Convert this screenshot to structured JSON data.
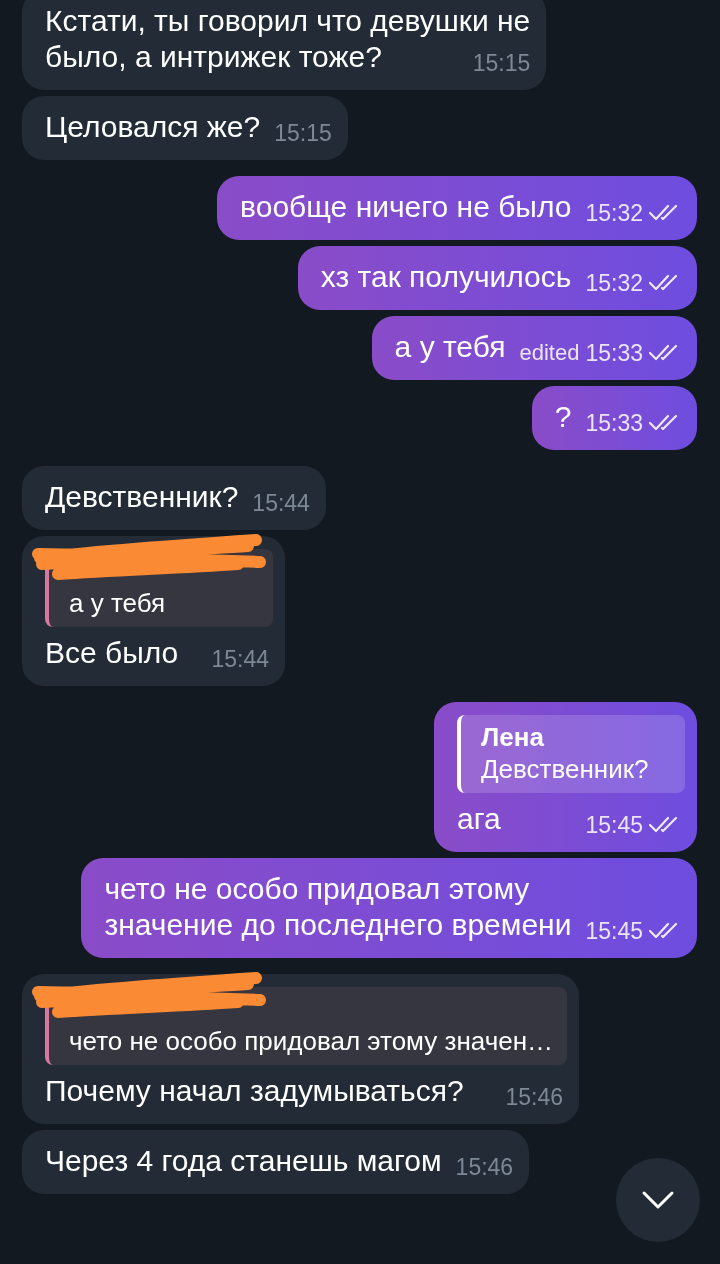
{
  "messages": [
    {
      "kind": "incoming",
      "text": "Кстати, ты говорил что девушки не\nбыло, а интрижек тоже?",
      "time": "15:15"
    },
    {
      "kind": "incoming",
      "text": "Целовался же?",
      "time": "15:15"
    },
    {
      "kind": "outgoing",
      "text": "вообще ничего не было",
      "time": "15:32",
      "read": true
    },
    {
      "kind": "outgoing",
      "text": "хз так получилось",
      "time": "15:32",
      "read": true
    },
    {
      "kind": "outgoing",
      "text": "а у тебя",
      "edited": "edited",
      "time": "15:33",
      "read": true
    },
    {
      "kind": "outgoing",
      "text": "?",
      "time": "15:33",
      "read": true
    },
    {
      "kind": "incoming",
      "text": "Девственник?",
      "time": "15:44"
    },
    {
      "kind": "incoming",
      "reply": {
        "text": "а у тебя",
        "redacted": true
      },
      "text": "Все было",
      "time": "15:44"
    },
    {
      "kind": "outgoing",
      "reply": {
        "name": "Лена",
        "text": "Девственник?",
        "redacted": false
      },
      "text": "ага",
      "time": "15:45",
      "read": true
    },
    {
      "kind": "outgoing",
      "text": "чето не особо придовал этому\nзначение до последнего времени",
      "time": "15:45",
      "read": true
    },
    {
      "kind": "incoming",
      "reply": {
        "text": "чето не особо придовал этому значен…",
        "redacted": true
      },
      "text": "Почему начал задумываться?",
      "time": "15:46"
    },
    {
      "kind": "incoming",
      "text": "Через 4 года станешь магом",
      "time": "15:46"
    }
  ],
  "scroll_down_button": {
    "visible": true
  }
}
